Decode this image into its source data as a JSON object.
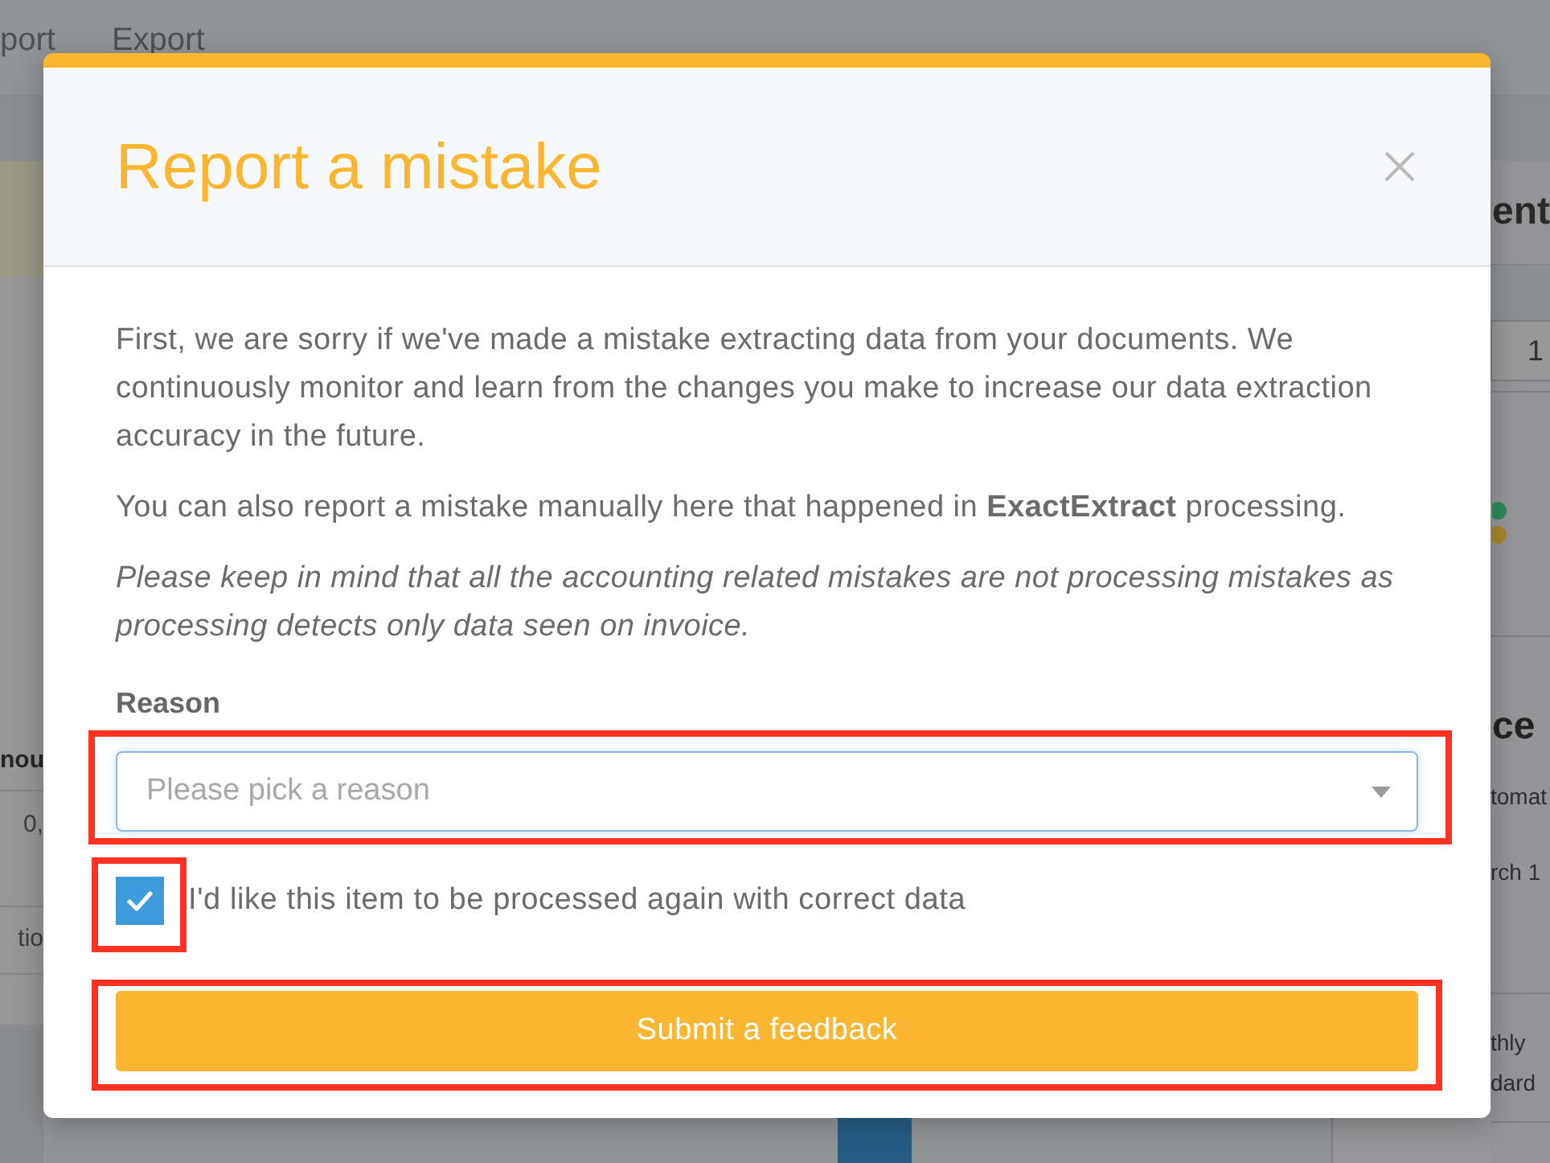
{
  "background": {
    "nav": [
      "port",
      "Export"
    ],
    "left_panel": {
      "column_header": "nou",
      "cells": [
        "0,",
        "tio"
      ]
    },
    "right_panel": {
      "title": "ent",
      "field_value": "1",
      "card_heading": "ce",
      "card_lines": [
        "tomat",
        "rch 1"
      ],
      "plan_lines": [
        "thly",
        "dard"
      ]
    }
  },
  "modal": {
    "title": "Report a mistake",
    "paragraphs": [
      {
        "kind": "plain",
        "text": "First, we are sorry if we've made a mistake extracting data from your documents. We continuously monitor and learn from the changes you make to increase our data extraction accuracy in the future."
      },
      {
        "kind": "plain",
        "text": "You can also report a mistake manually here that happened in **ExactExtract** processing."
      },
      {
        "kind": "note",
        "text": "Please keep in mind that all the accounting related mistakes are not processing mistakes as processing detects only data seen on invoice."
      }
    ],
    "reason": {
      "label": "Reason",
      "placeholder": "Please pick a reason",
      "highlighted": true
    },
    "reprocess": {
      "label": "I'd like this item to be processed again with correct data",
      "checked": true,
      "highlighted": true
    },
    "submit": {
      "label": "Submit a feedback",
      "highlighted": true
    }
  }
}
